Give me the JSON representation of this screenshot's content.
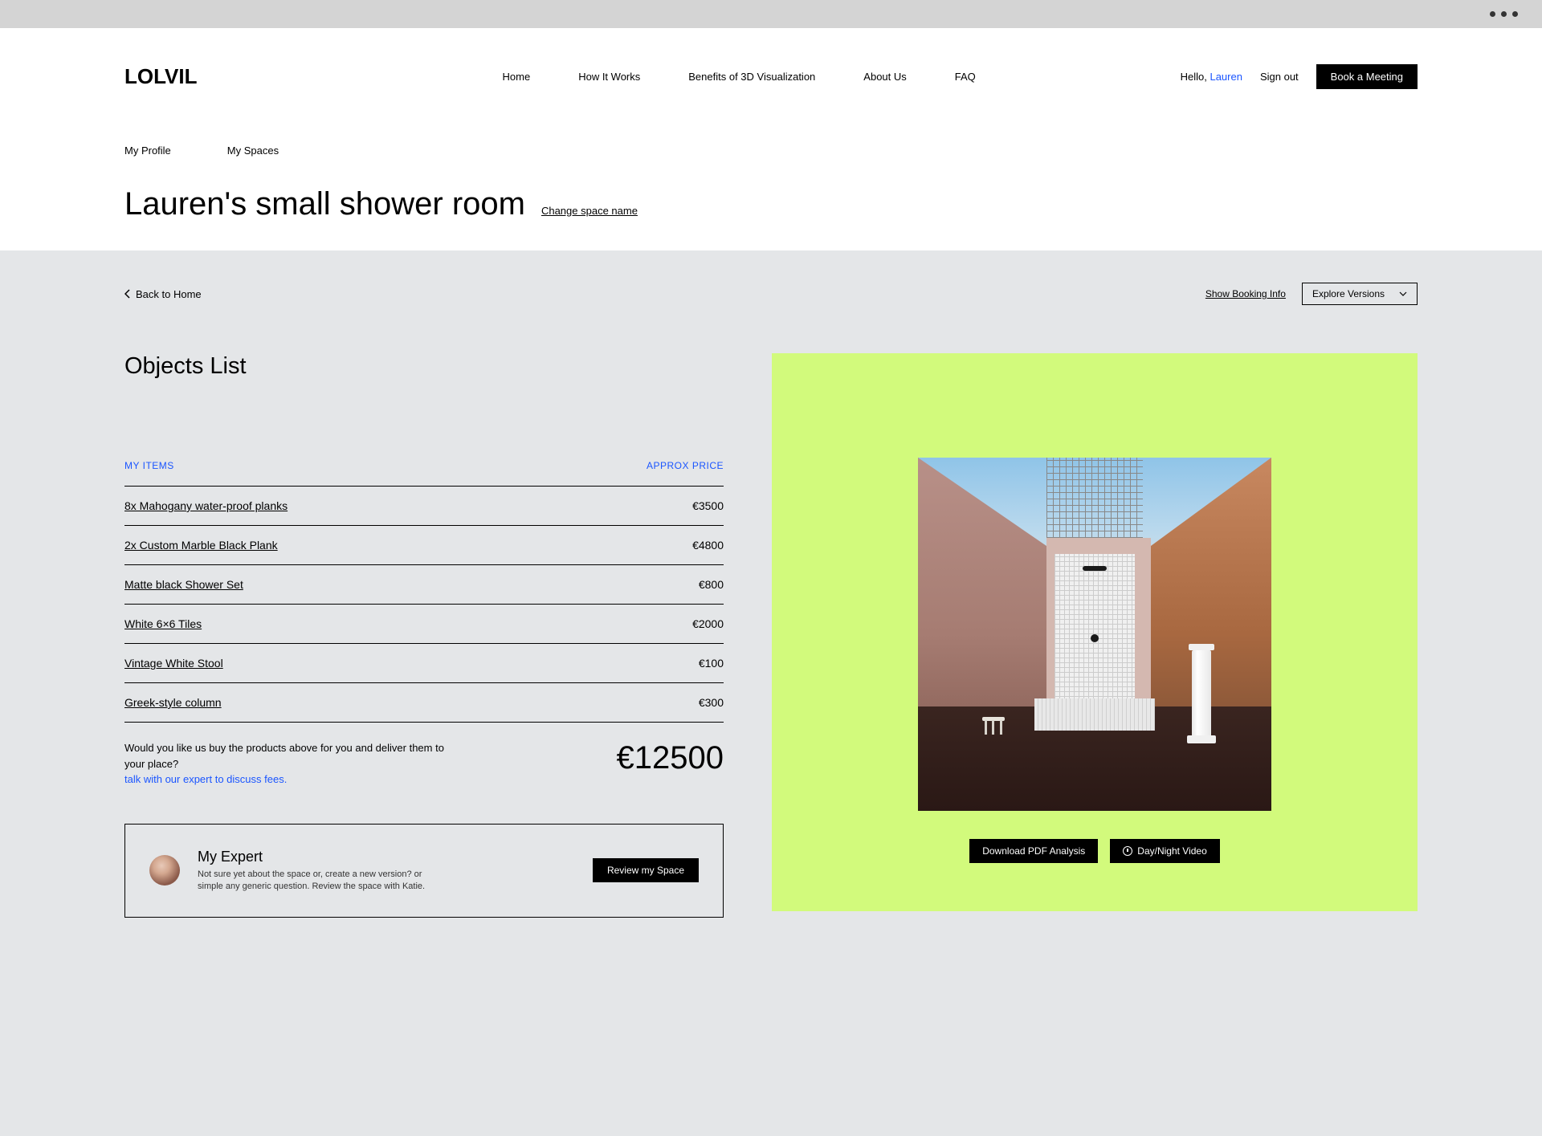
{
  "nav": {
    "logo": "LOLVIL",
    "links": [
      "Home",
      "How It Works",
      "Benefits of 3D Visualization",
      "About Us",
      "FAQ"
    ],
    "hello_prefix": "Hello, ",
    "user_name": "Lauren",
    "sign_out": "Sign out",
    "book_meeting": "Book a Meeting"
  },
  "tabs": {
    "profile": "My Profile",
    "spaces": "My Spaces"
  },
  "title": {
    "page_title": "Lauren's small shower room",
    "change_name": "Change  space name"
  },
  "toolbar": {
    "back": "Back to Home",
    "show_booking": "Show Booking Info",
    "explore": "Explore Versions"
  },
  "objects": {
    "title": "Objects List",
    "header_items": "MY ITEMS",
    "header_price": "APPROX PRICE",
    "items": [
      {
        "name": "8x Mahogany water-proof planks",
        "price": "€3500"
      },
      {
        "name": "2x Custom Marble Black Plank",
        "price": "€4800"
      },
      {
        "name": "Matte black Shower Set",
        "price": "€800"
      },
      {
        "name": "White 6×6 Tiles",
        "price": "€2000"
      },
      {
        "name": "Vintage White  Stool",
        "price": "€100"
      },
      {
        "name": "Greek-style column",
        "price": "€300"
      }
    ],
    "total_q": "Would you like us buy the products above for you and deliver them to your place?  ",
    "talk_expert": "talk with our expert to discuss fees.",
    "total": "€12500"
  },
  "expert": {
    "title": "My Expert",
    "desc": "Not sure yet about the space or, create a new version?  or simple any generic question. Review the space with Katie.",
    "review_btn": "Review my Space"
  },
  "render": {
    "download": "Download PDF Analysis",
    "daynight": "Day/Night Video"
  }
}
